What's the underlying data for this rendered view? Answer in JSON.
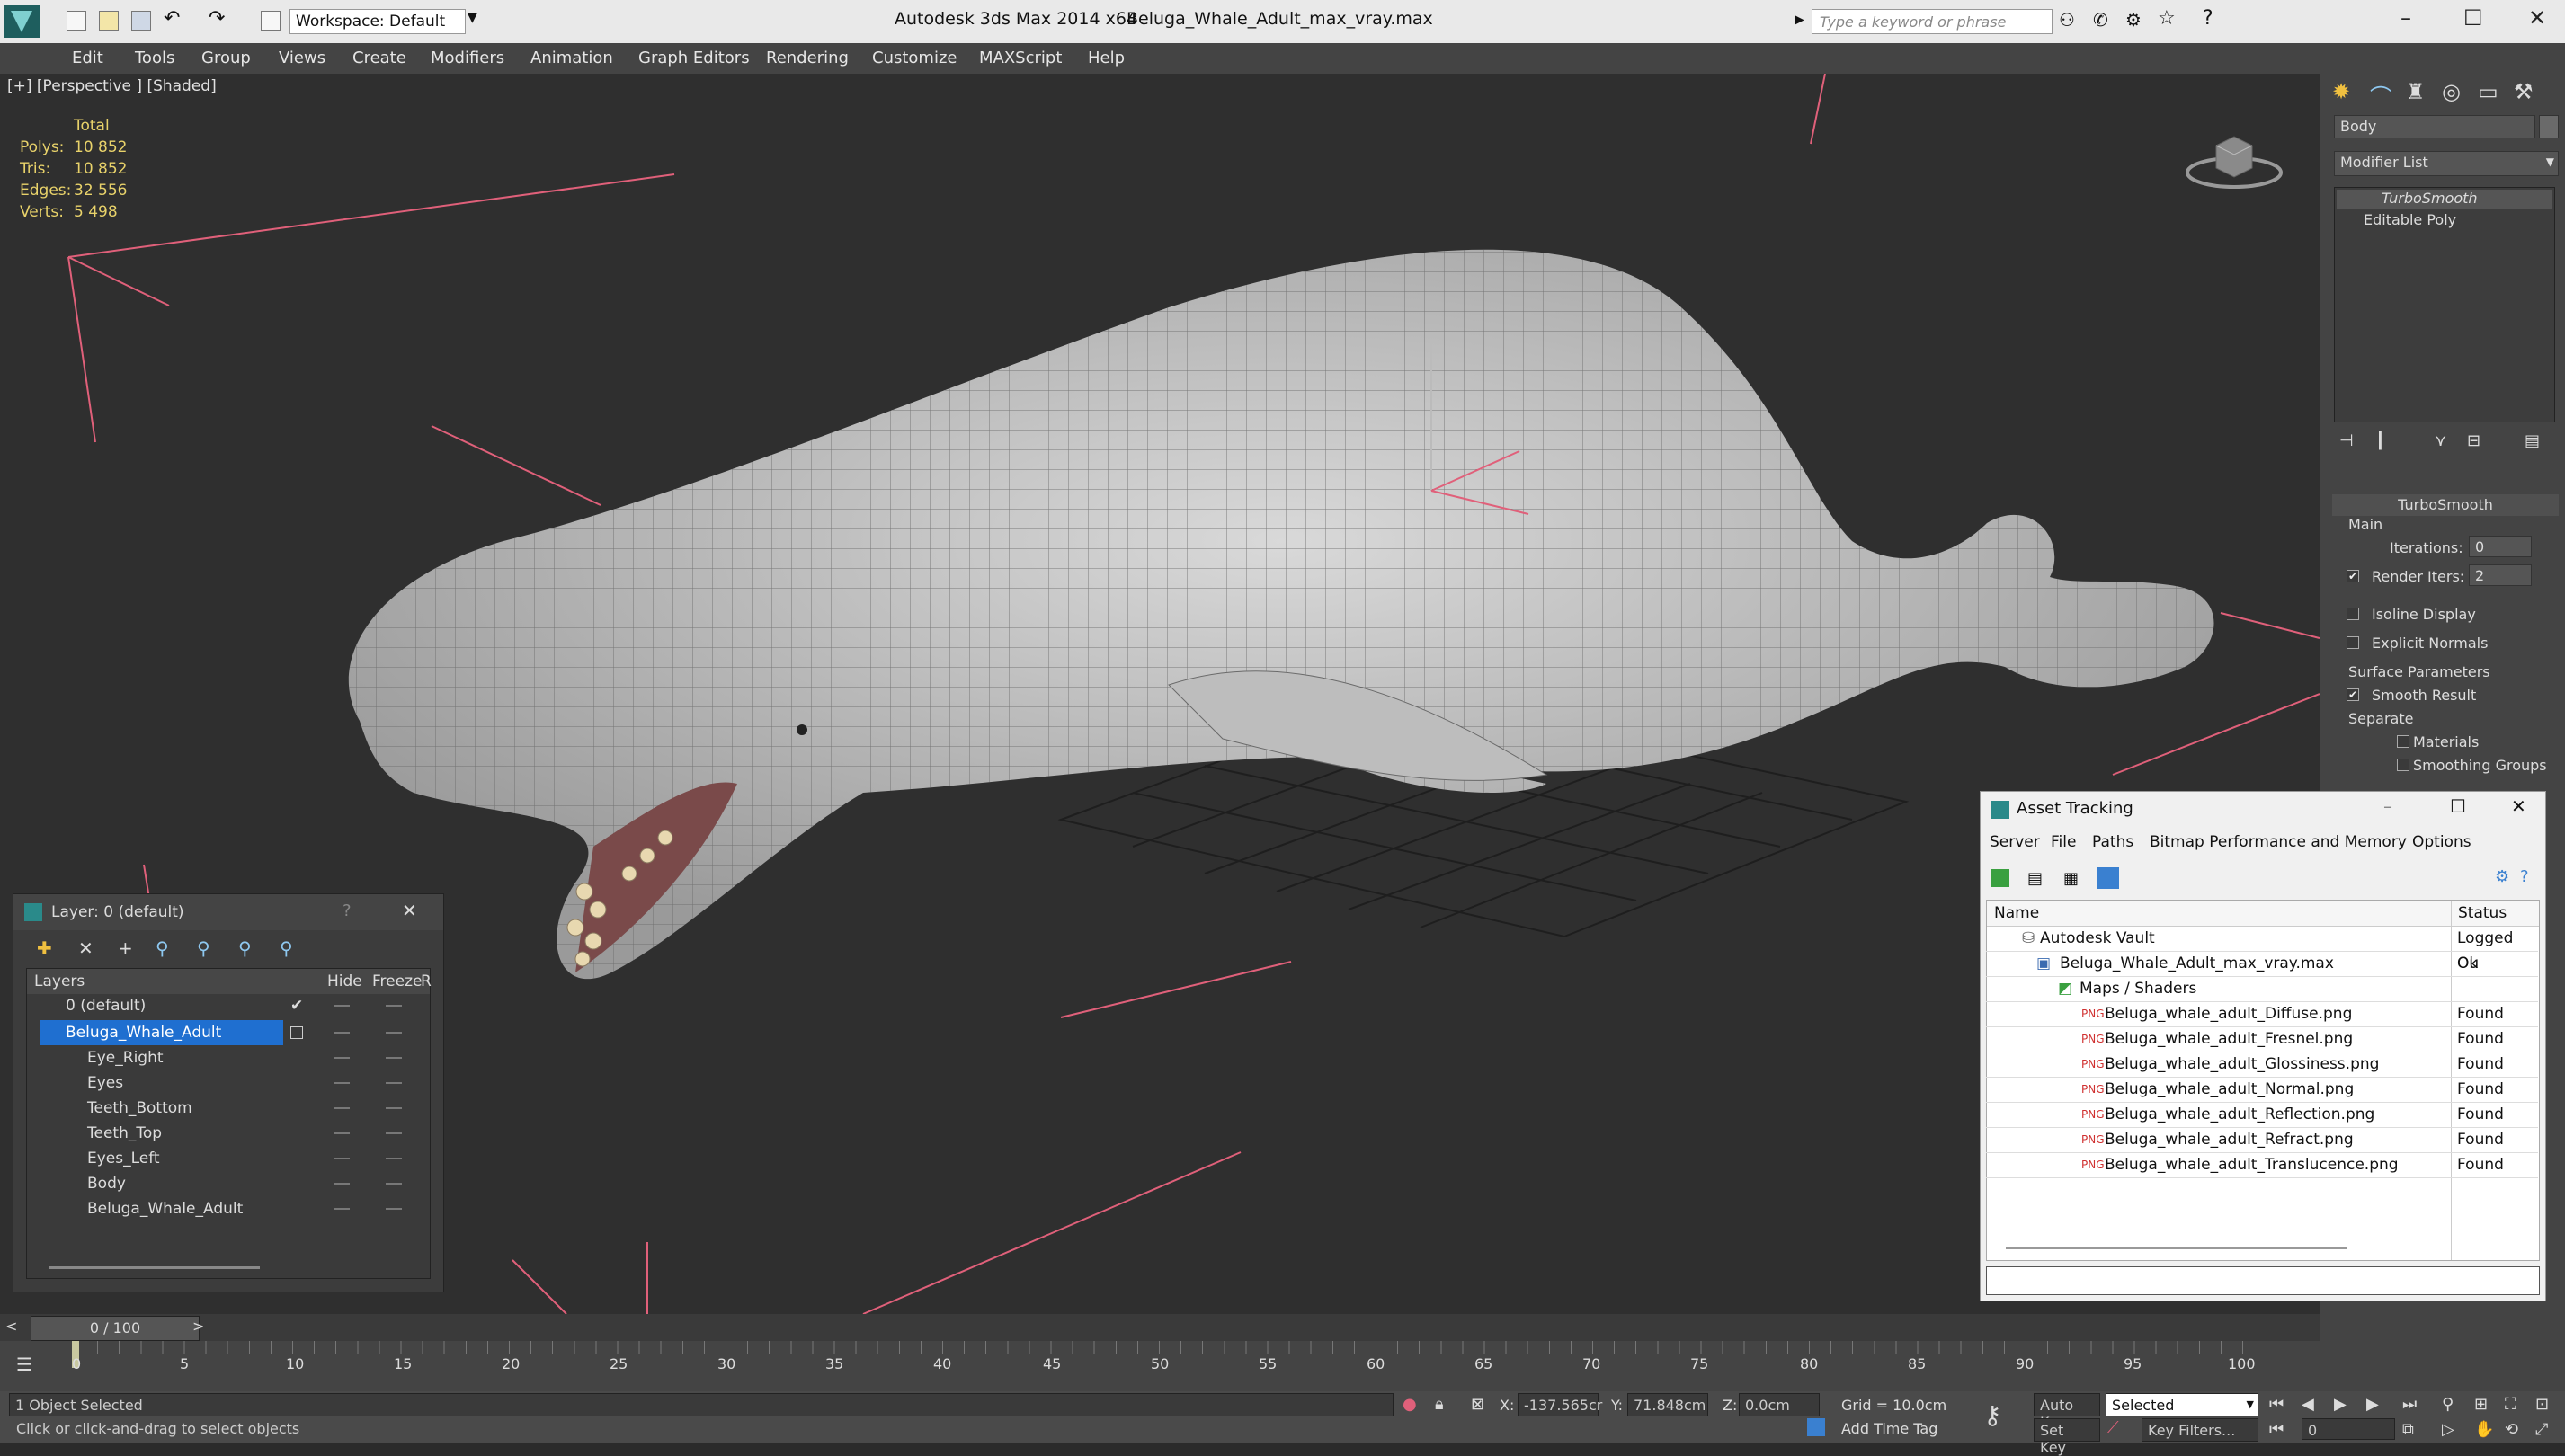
{
  "app": {
    "title": "Autodesk 3ds Max  2014 x64",
    "file": "Beluga_Whale_Adult_max_vray.max",
    "workspace": "Workspace: Default",
    "search_placeholder": "Type a keyword or phrase"
  },
  "menu": [
    "Edit",
    "Tools",
    "Group",
    "Views",
    "Create",
    "Modifiers",
    "Animation",
    "Graph Editors",
    "Rendering",
    "Customize",
    "MAXScript",
    "Help"
  ],
  "viewport": {
    "label": "[+] [Perspective ] [Shaded]",
    "stats": {
      "header": "Total",
      "rows": [
        {
          "label": "Polys:",
          "value": "10 852"
        },
        {
          "label": "Tris:",
          "value": "10 852"
        },
        {
          "label": "Edges:",
          "value": "32 556"
        },
        {
          "label": "Verts:",
          "value": "5 498"
        }
      ]
    }
  },
  "command_panel": {
    "object_name": "Body",
    "modifier_list": "Modifier List",
    "stack": [
      "TurboSmooth",
      "Editable Poly"
    ],
    "rollout_title": "TurboSmooth",
    "main_label": "Main",
    "iterations_label": "Iterations:",
    "iterations_value": "0",
    "render_iters_label": "Render Iters:",
    "render_iters_value": "2",
    "isoline": "Isoline Display",
    "explicit": "Explicit Normals",
    "surface_params": "Surface Parameters",
    "smooth_result": "Smooth Result",
    "separate": "Separate",
    "materials": "Materials",
    "smoothing_groups": "Smoothing Groups"
  },
  "layer_explorer": {
    "title": "Layer: 0 (default)",
    "col_layers": "Layers",
    "col_hide": "Hide",
    "col_freeze": "Freeze",
    "col_r": "R",
    "rows": [
      {
        "name": "0 (default)",
        "indent": 1
      },
      {
        "name": "Beluga_Whale_Adult",
        "indent": 1
      },
      {
        "name": "Eye_Right",
        "indent": 2
      },
      {
        "name": "Eyes",
        "indent": 2
      },
      {
        "name": "Teeth_Bottom",
        "indent": 2
      },
      {
        "name": "Teeth_Top",
        "indent": 2
      },
      {
        "name": "Eyes_Left",
        "indent": 2
      },
      {
        "name": "Body",
        "indent": 2
      },
      {
        "name": "Beluga_Whale_Adult",
        "indent": 2
      }
    ]
  },
  "asset_tracking": {
    "title": "Asset Tracking",
    "menu": [
      "Server",
      "File",
      "Paths",
      "Bitmap Performance and Memory",
      "Options"
    ],
    "col_name": "Name",
    "col_status": "Status",
    "rows": [
      {
        "name": "Autodesk Vault",
        "status": "Logged Ou",
        "indent": 1
      },
      {
        "name": "Beluga_Whale_Adult_max_vray.max",
        "status": "Ok",
        "indent": 2
      },
      {
        "name": "Maps / Shaders",
        "status": "",
        "indent": 3
      },
      {
        "name": "Beluga_whale_adult_Diffuse.png",
        "status": "Found",
        "indent": 4
      },
      {
        "name": "Beluga_whale_adult_Fresnel.png",
        "status": "Found",
        "indent": 4
      },
      {
        "name": "Beluga_whale_adult_Glossiness.png",
        "status": "Found",
        "indent": 4
      },
      {
        "name": "Beluga_whale_adult_Normal.png",
        "status": "Found",
        "indent": 4
      },
      {
        "name": "Beluga_whale_adult_Reflection.png",
        "status": "Found",
        "indent": 4
      },
      {
        "name": "Beluga_whale_adult_Refract.png",
        "status": "Found",
        "indent": 4
      },
      {
        "name": "Beluga_whale_adult_Translucence.png",
        "status": "Found",
        "indent": 4
      }
    ]
  },
  "timeline": {
    "frame": "0 / 100",
    "ticks": [
      "0",
      "5",
      "10",
      "15",
      "20",
      "25",
      "30",
      "35",
      "40",
      "45",
      "50",
      "55",
      "60",
      "65",
      "70",
      "75",
      "80",
      "85",
      "90",
      "95",
      "100"
    ]
  },
  "status": {
    "selected": "1 Object Selected",
    "prompt": "Click or click-and-drag to select objects",
    "x_label": "X:",
    "x_value": "-137.565cr",
    "y_label": "Y:",
    "y_value": "71.848cm",
    "z_label": "Z:",
    "z_value": "0.0cm",
    "grid": "Grid = 10.0cm",
    "add_time_tag": "Add Time Tag",
    "auto_key": "Auto Key",
    "set_key": "Set Key",
    "selected_dropdown": "Selected",
    "key_filters": "Key Filters...",
    "frame_field": "0"
  }
}
